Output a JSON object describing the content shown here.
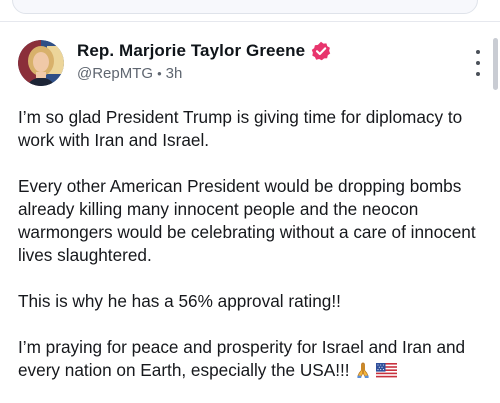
{
  "post": {
    "author": {
      "display_name": "Rep. Marjorie Taylor Greene",
      "handle": "@RepMTG",
      "separator": "•",
      "timestamp": "3h",
      "verified": true,
      "verified_color": "#e8356d"
    },
    "body": {
      "paragraphs": [
        "I’m so glad President Trump is giving time for diplomacy to work with Iran and Israel.",
        "Every other American President would be dropping bombs already killing many innocent people and the neocon warmongers would be celebrating without a care of innocent lives slaughtered.",
        "This is why he has a 56% approval rating!!",
        "I’m praying for peace and prosperity for Israel and Iran and every nation on Earth, especially the USA!!!"
      ],
      "trailing_emojis": [
        "praying-hands-icon",
        "us-flag-icon"
      ]
    },
    "menu_icon": "more-vertical-icon"
  },
  "colors": {
    "text": "#16181c",
    "muted": "#5f6670",
    "divider": "#e6e8ee"
  }
}
